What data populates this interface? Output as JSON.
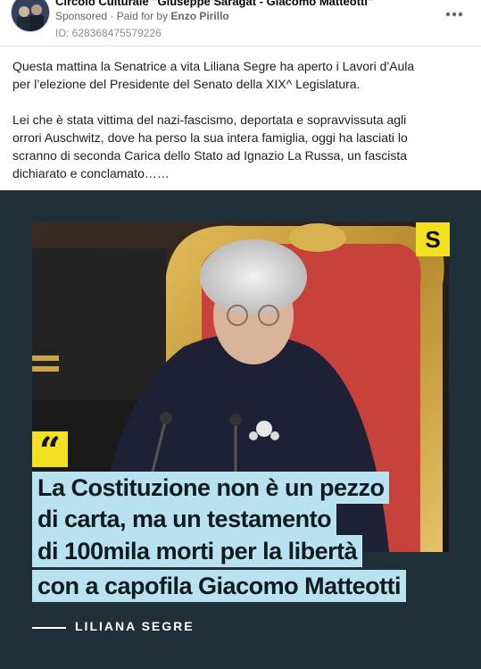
{
  "post": {
    "page_name": "Circolo Culturale \"Giuseppe Saragat - Giacomo Matteotti\"",
    "sponsored_label": "Sponsored",
    "separator": " · ",
    "paid_for_prefix": "Paid for by ",
    "payer": "Enzo Pirillo",
    "id_text": "ID: 628368475579226",
    "more_icon": "more-horizontal-icon",
    "text_paragraphs": [
      "Questa mattina la Senatrice a vita Liliana Segre ha aperto i Lavori d'Aula per l’elezione del Presidente del Senato della XIX^ Legislatura.",
      "Lei che è stata vittima del nazi-fascismo, deportata e sopravvissuta agli orrori Auschwitz, dove ha perso la sua intera famiglia, oggi ha lasciati lo scranno di seconda Carica dello Stato ad Ignazio La Russa, un fascista dichiarato e conclamato……"
    ]
  },
  "ad_image": {
    "logo_letter": "S",
    "quote_mark": "“",
    "quote_lines": [
      "La Costituzione non è un pezzo",
      "di carta, ma un testamento",
      "di 100mila morti per la libertà",
      "con a capofila Giacomo Matteotti"
    ],
    "author": "LILIANA SEGRE",
    "colors": {
      "background": "#1f2f38",
      "highlight": "#b9e2f1",
      "brand_yellow": "#f3e021"
    }
  }
}
